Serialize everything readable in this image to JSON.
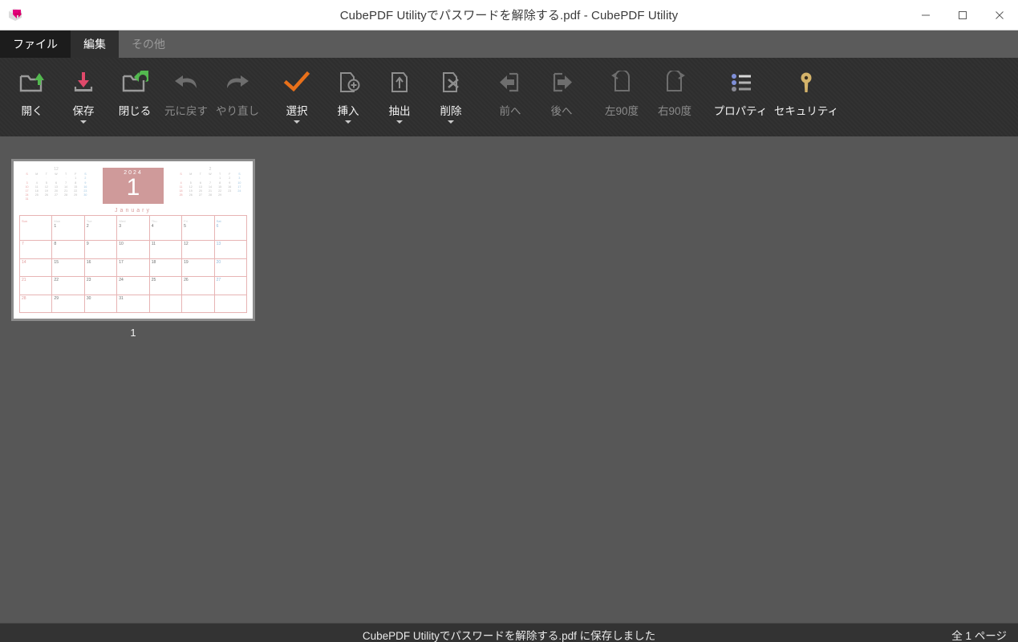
{
  "window": {
    "title": "CubePDF Utilityでパスワードを解除する.pdf - CubePDF Utility",
    "app_icon": "cubepdf-logo-icon",
    "minimize_label": "−",
    "maximize_label": "□",
    "close_label": "×"
  },
  "tabs": [
    {
      "label": "ファイル",
      "state": "file"
    },
    {
      "label": "編集",
      "state": "selected"
    },
    {
      "label": "その他",
      "state": "disabled"
    }
  ],
  "toolbar": {
    "items": [
      {
        "label": "開く",
        "icon": "folder-open-icon",
        "enabled": true,
        "caret": false
      },
      {
        "label": "保存",
        "icon": "save-icon",
        "enabled": true,
        "caret": true
      },
      {
        "label": "閉じる",
        "icon": "folder-close-icon",
        "enabled": true,
        "caret": false
      },
      {
        "label": "元に戻す",
        "icon": "undo-arrow-icon",
        "enabled": false,
        "caret": false
      },
      {
        "label": "やり直し",
        "icon": "redo-arrow-icon",
        "enabled": false,
        "caret": false
      },
      {
        "label": "選択",
        "icon": "checkmark-icon",
        "enabled": true,
        "caret": true
      },
      {
        "label": "挿入",
        "icon": "page-insert-icon",
        "enabled": true,
        "caret": true
      },
      {
        "label": "抽出",
        "icon": "page-extract-icon",
        "enabled": true,
        "caret": true
      },
      {
        "label": "削除",
        "icon": "page-delete-icon",
        "enabled": true,
        "caret": true
      },
      {
        "label": "前へ",
        "icon": "move-backward-icon",
        "enabled": false,
        "caret": false
      },
      {
        "label": "後へ",
        "icon": "move-forward-icon",
        "enabled": false,
        "caret": false
      },
      {
        "label": "左90度",
        "icon": "rotate-left-icon",
        "enabled": false,
        "caret": false
      },
      {
        "label": "右90度",
        "icon": "rotate-right-icon",
        "enabled": false,
        "caret": false
      },
      {
        "label": "プロパティ",
        "icon": "properties-list-icon",
        "enabled": true,
        "caret": false
      },
      {
        "label": "セキュリティ",
        "icon": "security-key-icon",
        "enabled": true,
        "caret": false
      }
    ]
  },
  "pages": [
    {
      "number": "1",
      "selected": true,
      "thumbnail": {
        "kind": "calendar-page",
        "year": "2024",
        "month_number": "1",
        "month_name": "January",
        "accent_color": "#cf9a9a",
        "grid_color": "#e7b4b4",
        "prev_month_title": "12",
        "next_month_title": "2",
        "dow_short": [
          "S",
          "M",
          "T",
          "W",
          "T",
          "F",
          "S"
        ],
        "dow_long": [
          "Sun",
          "Mon",
          "Tue",
          "Wed",
          "Thu",
          "Fri",
          "Sat"
        ],
        "weeks": [
          [
            "",
            "1",
            "2",
            "3",
            "4",
            "5",
            "6"
          ],
          [
            "7",
            "8",
            "9",
            "10",
            "11",
            "12",
            "13"
          ],
          [
            "14",
            "15",
            "16",
            "17",
            "18",
            "19",
            "20"
          ],
          [
            "21",
            "22",
            "23",
            "24",
            "25",
            "26",
            "27"
          ],
          [
            "28",
            "29",
            "30",
            "31",
            "",
            "",
            ""
          ]
        ],
        "prev_weeks": [
          [
            "",
            "",
            "",
            "",
            "",
            "1",
            "2"
          ],
          [
            "3",
            "4",
            "5",
            "6",
            "7",
            "8",
            "9"
          ],
          [
            "10",
            "11",
            "12",
            "13",
            "14",
            "15",
            "16"
          ],
          [
            "17",
            "18",
            "19",
            "20",
            "21",
            "22",
            "23"
          ],
          [
            "24",
            "25",
            "26",
            "27",
            "28",
            "29",
            "30"
          ],
          [
            "31",
            "",
            "",
            "",
            "",
            "",
            ""
          ]
        ],
        "next_weeks": [
          [
            "",
            "",
            "",
            "",
            "1",
            "2",
            "3"
          ],
          [
            "4",
            "5",
            "6",
            "7",
            "8",
            "9",
            "10"
          ],
          [
            "11",
            "12",
            "13",
            "14",
            "15",
            "16",
            "17"
          ],
          [
            "18",
            "19",
            "20",
            "21",
            "22",
            "23",
            "24"
          ],
          [
            "25",
            "26",
            "27",
            "28",
            "29",
            "",
            ""
          ]
        ]
      }
    }
  ],
  "statusbar": {
    "message": "CubePDF Utilityでパスワードを解除する.pdf に保存しました",
    "page_count": "全 1 ページ"
  },
  "colors": {
    "titlebar_bg": "#ffffff",
    "toolbar_bg": "#2f2f2f",
    "content_bg": "#575757",
    "statusbar_bg": "#333333",
    "accent_orange": "#e8701a",
    "accent_green": "#53b84f",
    "accent_red": "#e0496a",
    "accent_gold": "#d4b36a",
    "accent_blue": "#7f8fd8",
    "disabled_gray": "#6e6e6e"
  }
}
